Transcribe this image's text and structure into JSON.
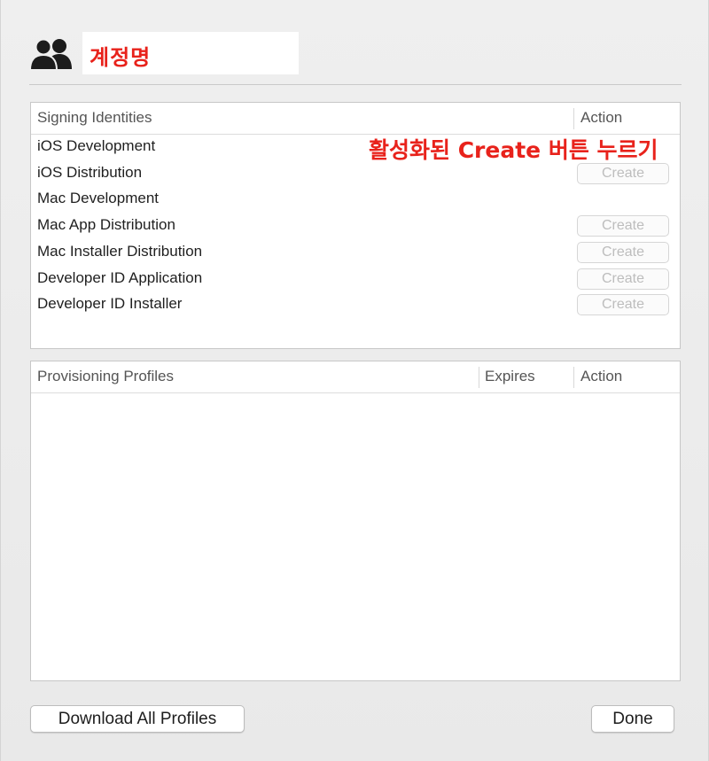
{
  "account": {
    "name": "계정명",
    "icon": "users-icon"
  },
  "signing": {
    "headers": {
      "identity": "Signing Identities",
      "action": "Action"
    },
    "rows": [
      {
        "label": "iOS Development",
        "button": ""
      },
      {
        "label": "iOS Distribution",
        "button": "Create"
      },
      {
        "label": "Mac Development",
        "button": ""
      },
      {
        "label": "Mac App Distribution",
        "button": "Create"
      },
      {
        "label": "Mac Installer Distribution",
        "button": "Create"
      },
      {
        "label": "Developer ID Application",
        "button": "Create"
      },
      {
        "label": "Developer ID Installer",
        "button": "Create"
      }
    ]
  },
  "annotation": "활성화된 Create 버튼 누르기",
  "profiles": {
    "headers": {
      "name": "Provisioning Profiles",
      "expires": "Expires",
      "action": "Action"
    },
    "rows": []
  },
  "footer": {
    "download_label": "Download All Profiles",
    "done_label": "Done"
  },
  "colors": {
    "annotation": "#e8221b",
    "disabled_text": "#bdbdbd"
  }
}
